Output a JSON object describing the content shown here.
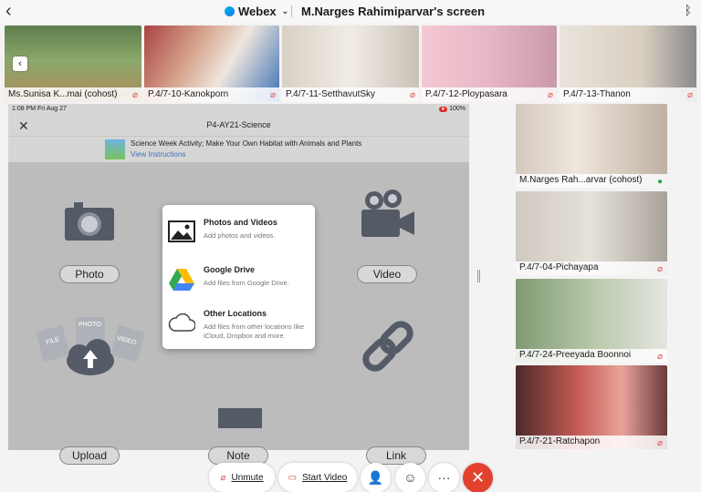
{
  "topbar": {
    "back_icon": "chevron-left-icon",
    "app_name": "Webex",
    "screen_title": "M.Narges Rahimiparvar's screen",
    "bluetooth_icon": "bluetooth-icon"
  },
  "strip": {
    "participants": [
      {
        "name": "Ms.Sunisa K...mai (cohost)",
        "muted": true
      },
      {
        "name": "P.4/7-10-Kanokporn",
        "muted": true
      },
      {
        "name": "P.4/7-11-SetthavutSky",
        "muted": true
      },
      {
        "name": "P.4/7-12-Ploypasara",
        "muted": true
      },
      {
        "name": "P.4/7-13-Thanon",
        "muted": true
      }
    ]
  },
  "shared": {
    "status_time": "1:08 PM  Fri Aug 27",
    "status_battery": "100%",
    "app_title": "P4-AY21-Science",
    "activity_title": "Science Week Activity; Make Your Own Habitat with Animals and Plants",
    "activity_link": "View Instructions",
    "options": {
      "photo": "Photo",
      "video": "Video",
      "upload": "Upload",
      "note": "Note",
      "link": "Link"
    },
    "upload_tags": {
      "file": "FILE",
      "photo": "PHOTO",
      "video": "VIDEO"
    },
    "popup": [
      {
        "title": "Photos and Videos",
        "desc": "Add photos and videos."
      },
      {
        "title": "Google Drive",
        "desc": "Add files from Google Drive."
      },
      {
        "title": "Other Locations",
        "desc": "Add files from other locations like iCloud, Dropbox and more."
      }
    ]
  },
  "right_participants": [
    {
      "name": "M.Narges Rah...arvar (cohost)",
      "mic": "on"
    },
    {
      "name": "P.4/7-04-Pichayapa",
      "mic": "muted"
    },
    {
      "name": "P.4/7-24-Preeyada Boonnoi",
      "mic": "muted"
    },
    {
      "name": "P.4/7-21-Ratchapon",
      "mic": "muted"
    }
  ],
  "toolbar": {
    "unmute": "Unmute",
    "start_video": "Start Video",
    "more": "···"
  },
  "colors": {
    "end_button": "#e2412e",
    "muted_mic": "#d9534f",
    "active_mic": "#2aa84a"
  }
}
